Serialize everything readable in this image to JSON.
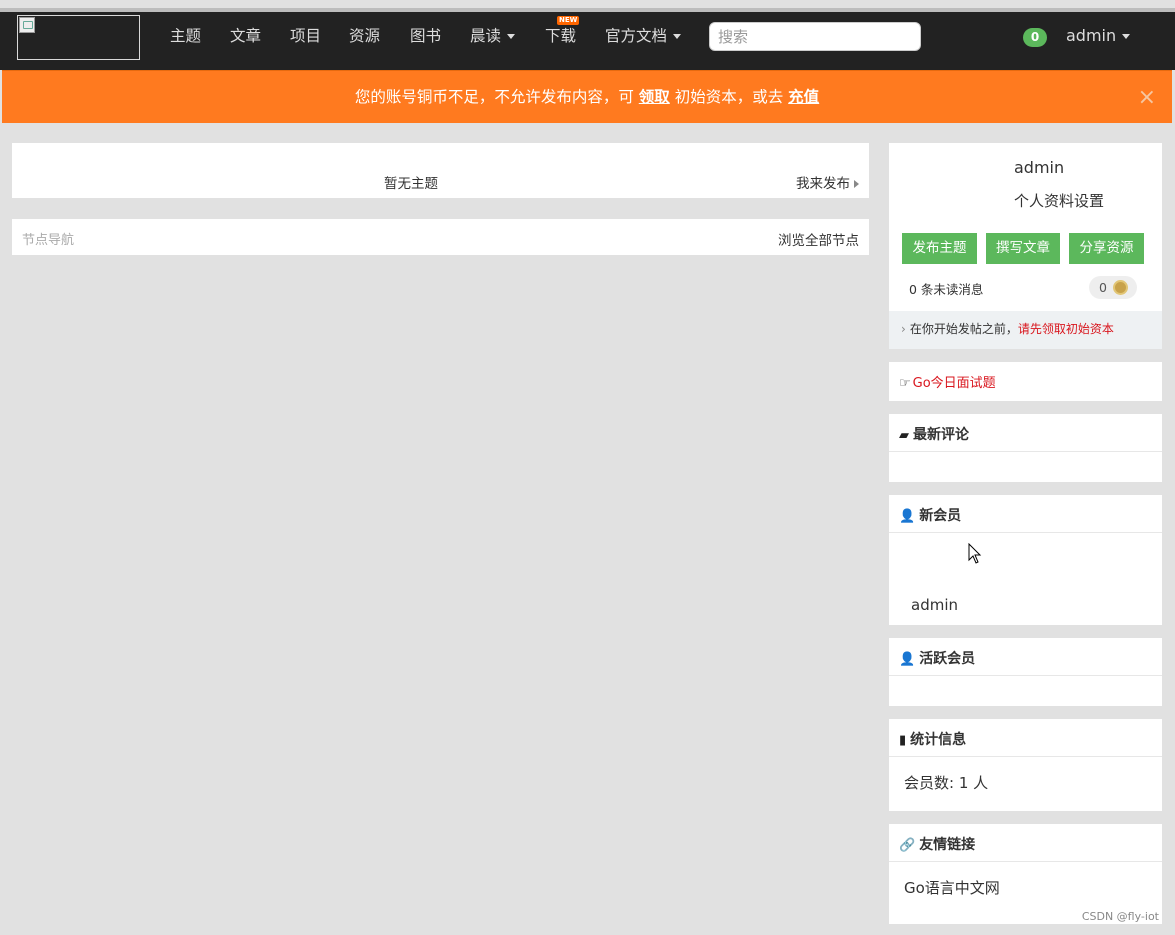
{
  "nav": {
    "items": [
      {
        "label": "主题",
        "dropdown": false
      },
      {
        "label": "文章",
        "dropdown": false
      },
      {
        "label": "项目",
        "dropdown": false
      },
      {
        "label": "资源",
        "dropdown": false
      },
      {
        "label": "图书",
        "dropdown": false
      },
      {
        "label": "晨读",
        "dropdown": true
      },
      {
        "label": "下载",
        "dropdown": false,
        "badge": "NEW"
      },
      {
        "label": "官方文档",
        "dropdown": true
      }
    ],
    "search_placeholder": "搜索",
    "notification_count": "0",
    "username": "admin"
  },
  "alert": {
    "prefix": "您的账号铜币不足，不允许发布内容，可",
    "link1": "领取",
    "middle": "初始资本，或去",
    "link2": "充值",
    "close": "×"
  },
  "topics": {
    "empty_text": "暂无主题",
    "publish_link": "我来发布"
  },
  "nodes": {
    "title": "节点导航",
    "browse_all": "浏览全部节点"
  },
  "profile": {
    "username": "admin",
    "settings": "个人资料设置",
    "buttons": [
      "发布主题",
      "撰写文章",
      "分享资源"
    ],
    "unread": "0 条未读消息",
    "coins": "0",
    "tip_prefix": "在你开始发帖之前，",
    "tip_link": "请先领取初始资本"
  },
  "go_daily": "Go今日面试题",
  "widgets": {
    "comments": "最新评论",
    "new_members": "新会员",
    "new_member_name": "admin",
    "active_members": "活跃会员",
    "stats": "统计信息",
    "stats_members": "会员数: 1 人",
    "links": "友情链接",
    "links_item": "Go语言中文网"
  },
  "watermark": "CSDN @fly-iot",
  "colors": {
    "navbar": "#222222",
    "alert": "#ff7a1f",
    "green": "#5cb85c",
    "red_link": "#d9161e"
  }
}
